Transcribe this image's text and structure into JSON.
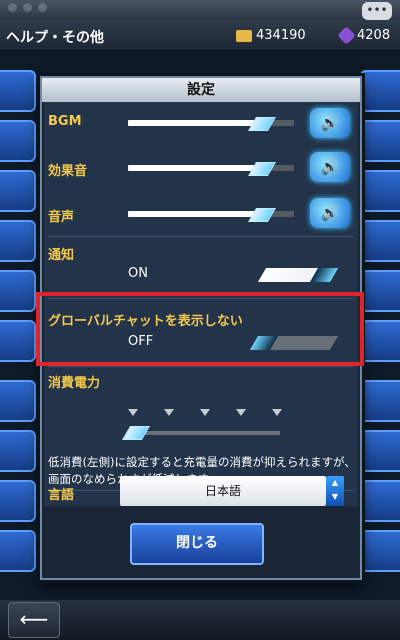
{
  "screen": {
    "title": "ヘルプ・その他",
    "gold": "434190",
    "gems": "4208",
    "back_glyph": "⟵"
  },
  "modal": {
    "title": "設定",
    "rows": {
      "bgm": {
        "label": "BGM",
        "level": 0.75
      },
      "sfx": {
        "label": "効果音",
        "level": 0.75
      },
      "voice": {
        "label": "音声",
        "level": 0.75
      }
    },
    "notifications": {
      "label": "通知",
      "state": "ON"
    },
    "global_chat": {
      "label": "グローバルチャットを表示しない",
      "state": "OFF"
    },
    "power": {
      "label": "消費電力",
      "level_index": 0,
      "steps": 5,
      "description": "低消費(左側)に設定すると充電量の消費が抑えられますが、画面のなめらかさが低減します"
    },
    "language": {
      "label": "言語",
      "value": "日本語"
    },
    "close_label": "閉じる"
  },
  "colors": {
    "accent_yellow": "#f5c94a",
    "highlight_red": "#e0242b",
    "button_blue": "#2a64d0"
  }
}
